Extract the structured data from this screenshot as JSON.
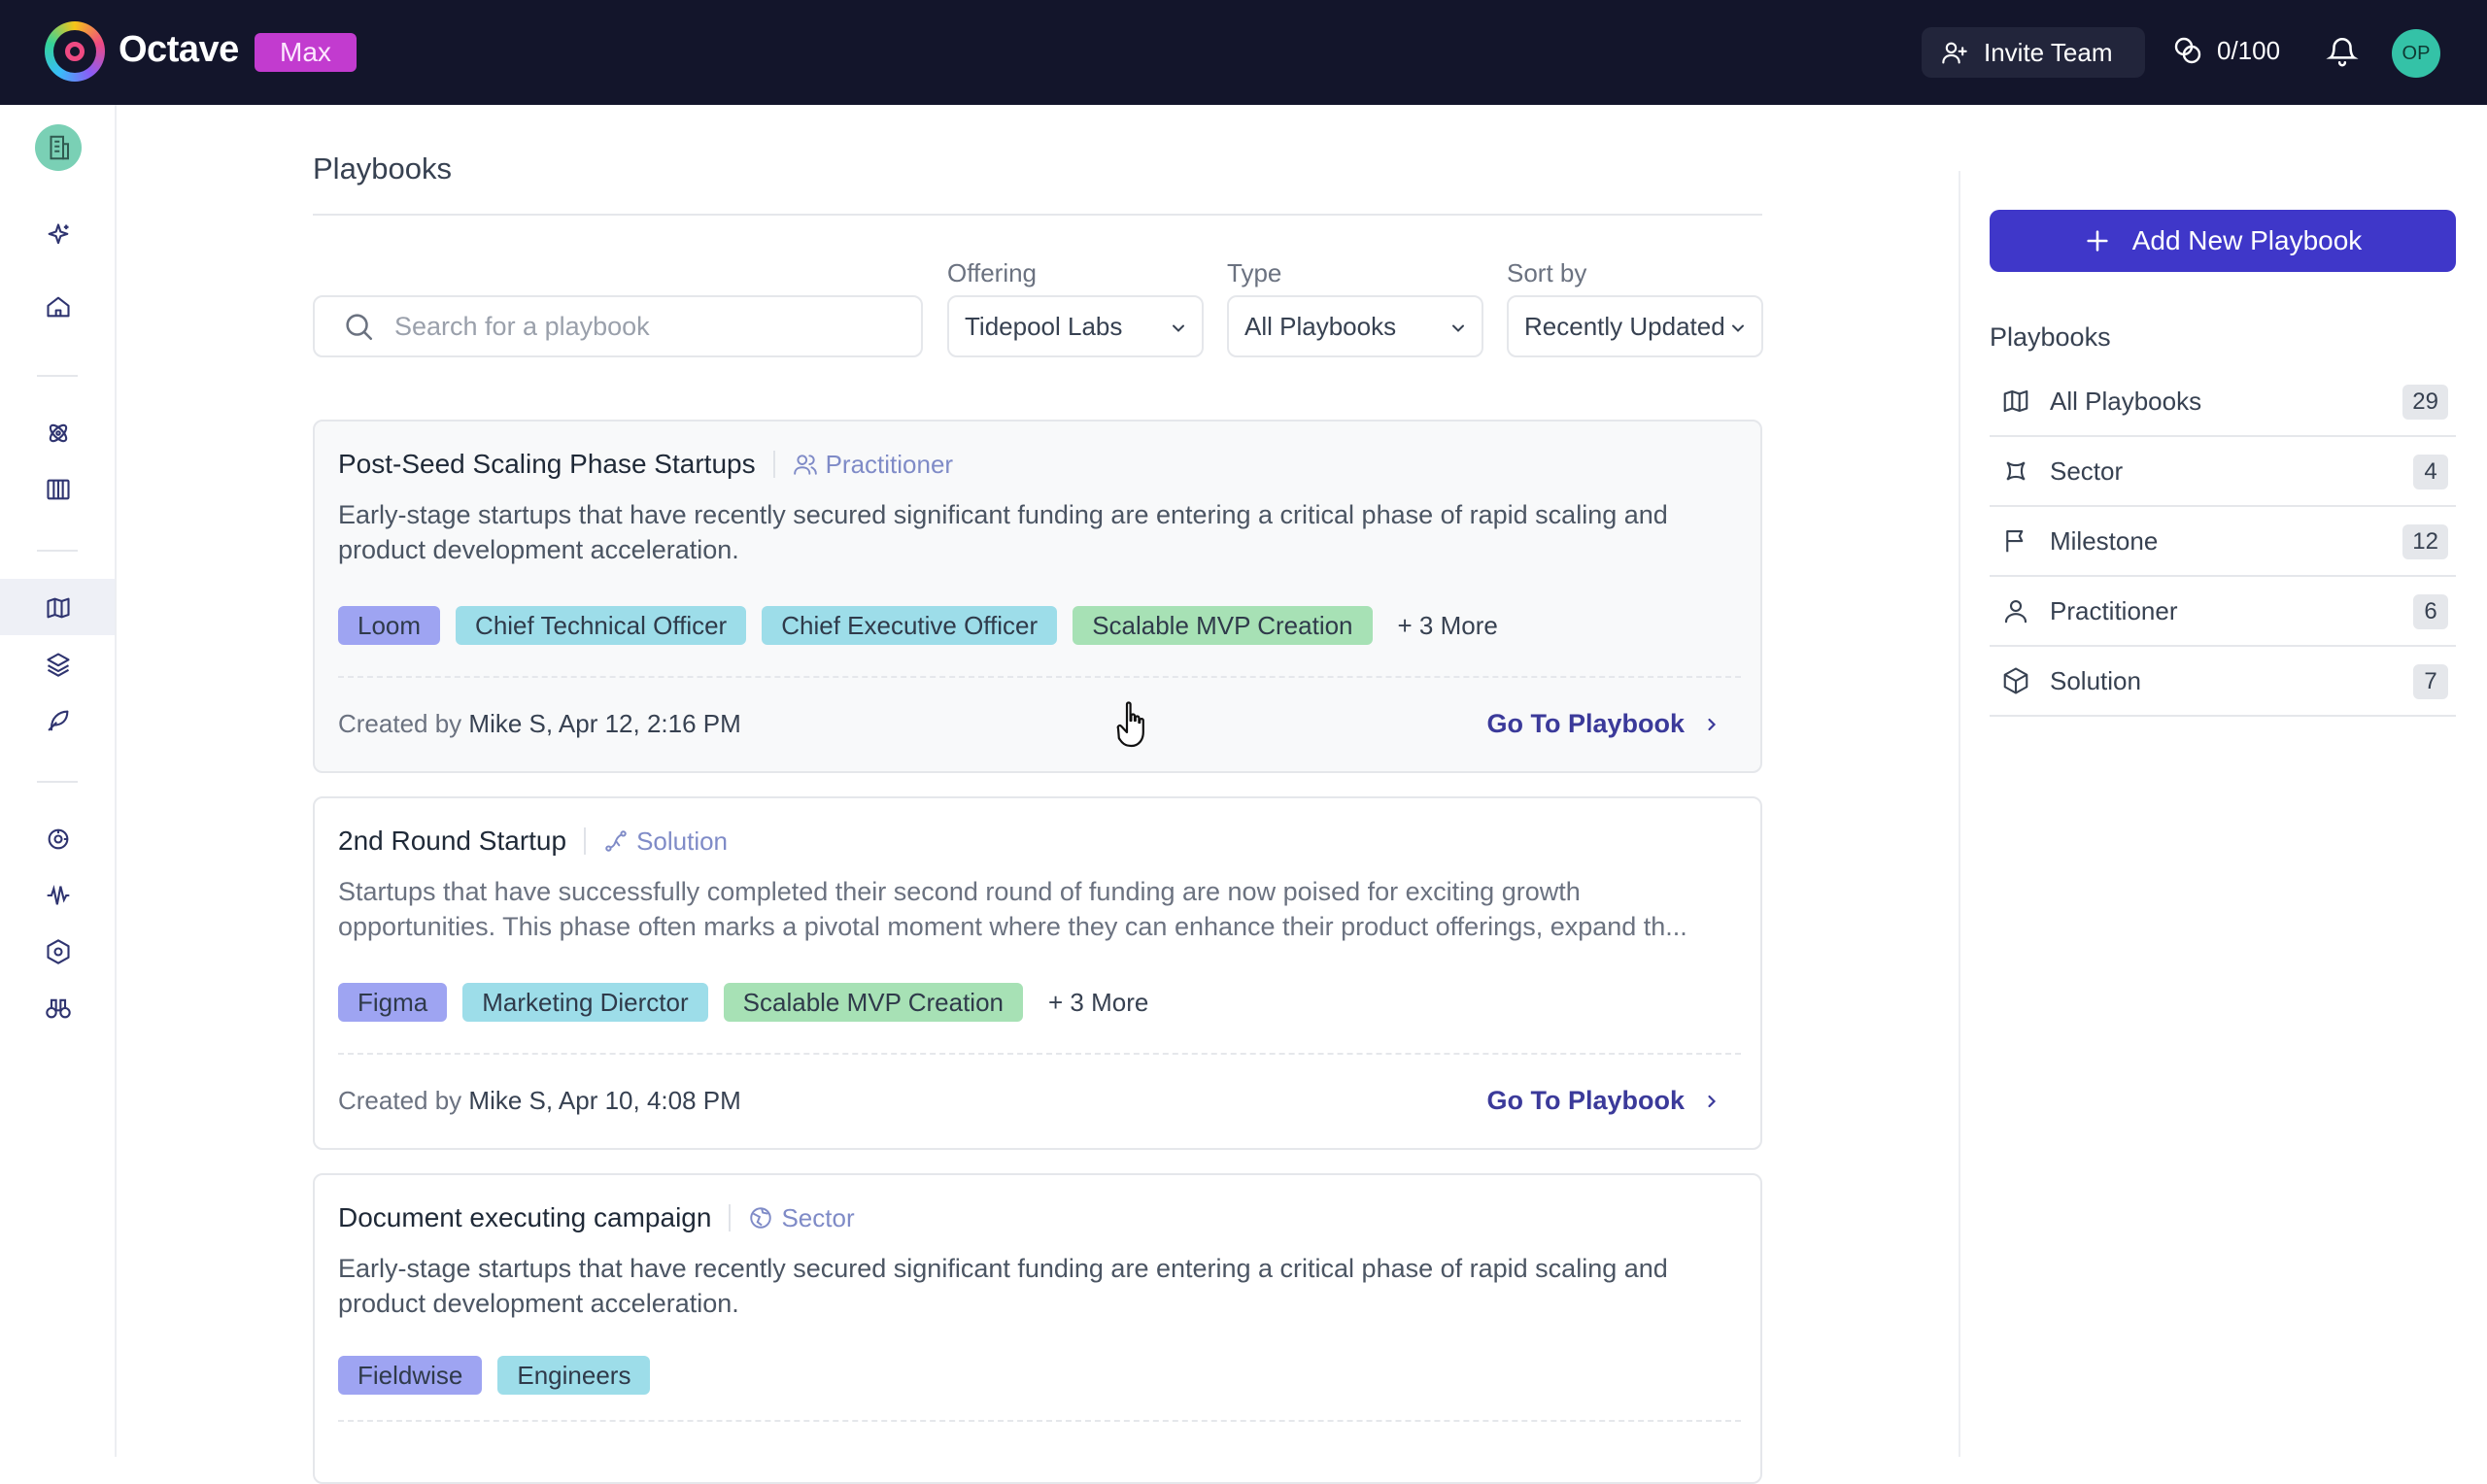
{
  "app": {
    "name": "Octave",
    "plan_badge": "Max"
  },
  "topbar": {
    "invite_label": "Invite Team",
    "credits": "0/100",
    "avatar_initials": "OP"
  },
  "main": {
    "title": "Playbooks",
    "search": {
      "placeholder": "Search for a playbook",
      "value": ""
    },
    "filters": {
      "offering": {
        "label": "Offering",
        "value": "Tidepool Labs"
      },
      "type": {
        "label": "Type",
        "value": "All Playbooks"
      },
      "sort": {
        "label": "Sort by",
        "value": "Recently Updated"
      }
    },
    "created_prefix": "Created by",
    "go_label": "Go To Playbook",
    "cards": [
      {
        "title": "Post-Seed Scaling Phase Startups",
        "type": "Practitioner",
        "type_icon": "user-group-icon",
        "description": "Early-stage startups that have recently secured significant funding are entering a critical phase of rapid scaling and product development acceleration.",
        "tags": [
          "Loom",
          "Chief Technical Officer",
          "Chief Executive Officer",
          "Scalable MVP Creation"
        ],
        "more": "+ 3 More",
        "created_by": "Mike S, Apr 12, 2:16 PM"
      },
      {
        "title": "2nd Round Startup",
        "type": "Solution",
        "type_icon": "route-icon",
        "description": "Startups that have successfully completed their second round of funding are now poised for exciting growth opportunities. This phase often marks a pivotal moment where they can enhance their product offerings, expand th...",
        "tags": [
          "Figma",
          "Marketing Dierctor",
          "Scalable MVP Creation"
        ],
        "more": "+ 3 More",
        "created_by": "Mike S, Apr 10, 4:08 PM"
      },
      {
        "title": "Document executing campaign",
        "type": "Sector",
        "type_icon": "globe-icon",
        "description": "Early-stage startups that have recently secured significant funding are entering a critical phase of rapid scaling and product development acceleration.",
        "tags": [
          "Fieldwise",
          "Engineers"
        ],
        "more": "",
        "created_by": ""
      }
    ]
  },
  "sidebar_right": {
    "add_button": "Add New Playbook",
    "title": "Playbooks",
    "items": [
      {
        "label": "All Playbooks",
        "count": "29",
        "icon": "map-icon"
      },
      {
        "label": "Sector",
        "count": "4",
        "icon": "sector-icon"
      },
      {
        "label": "Milestone",
        "count": "12",
        "icon": "flag-icon"
      },
      {
        "label": "Practitioner",
        "count": "6",
        "icon": "user-icon"
      },
      {
        "label": "Solution",
        "count": "7",
        "icon": "cube-icon"
      }
    ]
  },
  "rail": {
    "icons": [
      "company-icon",
      "sparkle-icon",
      "home-icon",
      "atom-icon",
      "library-icon",
      "map-icon",
      "layers-icon",
      "feather-icon",
      "target-icon",
      "waveform-icon",
      "hexagon-icon",
      "binoculars-icon"
    ]
  },
  "colors": {
    "topbar_bg": "#13152b",
    "plan_badge": "#c23bcf",
    "primary_button": "#3f37c9",
    "link": "#3b3a9a",
    "tag_purple": "#9ea4f2",
    "tag_cyan": "#9ddde9",
    "tag_green": "#a7e1b5"
  }
}
